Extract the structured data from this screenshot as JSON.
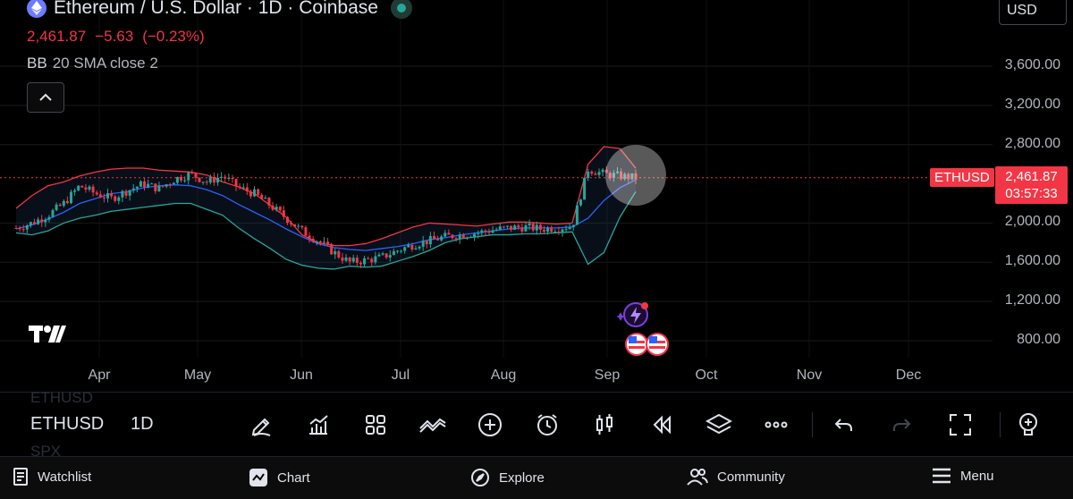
{
  "header": {
    "title": "Ethereum / U.S. Dollar · 1D · Coinbase",
    "price": "2,461.87",
    "change": "−5.63",
    "change_pct": "(−0.23%)",
    "indicator_name": "BB",
    "indicator_params": "20 SMA close 2"
  },
  "currency": {
    "value": "USD"
  },
  "price_axis": {
    "labels": [
      "3,600.00",
      "3,200.00",
      "2,800.00",
      "2,000.00",
      "1,600.00",
      "1,200.00",
      "800.00"
    ],
    "values": [
      3600,
      3200,
      2800,
      2000,
      1600,
      1200,
      800
    ]
  },
  "time_axis": {
    "labels": [
      "Apr",
      "May",
      "Jun",
      "Jul",
      "Aug",
      "Sep",
      "Oct",
      "Nov",
      "Dec"
    ]
  },
  "last_price_tag": {
    "symbol": "ETHUSD",
    "price": "2,461.87",
    "countdown": "03:57:33"
  },
  "colors": {
    "up": "#26a69a",
    "down": "#f23645",
    "bb_upper": "#f23645",
    "bb_basis": "#2962ff",
    "bb_lower": "#26a69a"
  },
  "toolbar": {
    "symbol": "ETHUSD",
    "interval": "1D",
    "ghost_top": "ETHUSD",
    "ghost_bottom": "SPX",
    "icons": [
      "draw-pen-icon",
      "indicators-icon",
      "grid-layout-icon",
      "compare-icon",
      "add-icon",
      "alert-clock-icon",
      "candles-icon",
      "replay-icon",
      "layers-icon",
      "more-icon",
      "undo-icon",
      "redo-icon",
      "fullscreen-icon",
      "idea-bulb-icon"
    ]
  },
  "bottom_nav": {
    "items": [
      {
        "label": "Watchlist",
        "icon": "watchlist-icon"
      },
      {
        "label": "Chart",
        "icon": "chart-icon"
      },
      {
        "label": "Explore",
        "icon": "compass-icon"
      },
      {
        "label": "Community",
        "icon": "people-icon"
      },
      {
        "label": "Menu",
        "icon": "hamburger-icon"
      }
    ]
  },
  "chart_data": {
    "type": "candlestick",
    "symbol": "ETHUSD",
    "interval": "1D",
    "y_range": [
      700,
      3800
    ],
    "x_months": [
      "Apr",
      "May",
      "Jun",
      "Jul",
      "Aug",
      "Sep",
      "Oct",
      "Nov",
      "Dec"
    ],
    "last_price": 2461.87,
    "close_series": [
      1950,
      2000,
      2080,
      2200,
      2380,
      2300,
      2250,
      2330,
      2400,
      2350,
      2450,
      2500,
      2420,
      2480,
      2360,
      2300,
      2180,
      2050,
      1920,
      1820,
      1700,
      1600,
      1620,
      1650,
      1720,
      1780,
      1820,
      1860,
      1880,
      1900,
      1930,
      1950,
      1960,
      1940,
      1950,
      1970,
      2550,
      2500,
      2480,
      2461.87
    ],
    "bb_upper": [
      2150,
      2280,
      2380,
      2420,
      2480,
      2520,
      2550,
      2560,
      2560,
      2540,
      2530,
      2520,
      2490,
      2420,
      2370,
      2300,
      2180,
      2060,
      1880,
      1800,
      1770,
      1770,
      1790,
      1840,
      1900,
      1960,
      2000,
      1990,
      1980,
      1970,
      1990,
      2010,
      2010,
      2000,
      1990,
      2000,
      2600,
      2780,
      2760,
      2560
    ],
    "bb_basis": [
      1940,
      1980,
      2040,
      2110,
      2200,
      2250,
      2300,
      2320,
      2360,
      2380,
      2390,
      2380,
      2340,
      2280,
      2190,
      2110,
      2030,
      1940,
      1860,
      1790,
      1750,
      1730,
      1720,
      1740,
      1760,
      1790,
      1830,
      1850,
      1880,
      1900,
      1920,
      1940,
      1950,
      1950,
      1950,
      1960,
      2050,
      2230,
      2360,
      2440
    ],
    "bb_lower": [
      1900,
      1880,
      1920,
      2000,
      2050,
      2080,
      2120,
      2140,
      2160,
      2180,
      2200,
      2200,
      2140,
      2080,
      1950,
      1840,
      1740,
      1630,
      1570,
      1540,
      1530,
      1560,
      1550,
      1560,
      1610,
      1660,
      1720,
      1800,
      1840,
      1860,
      1880,
      1880,
      1890,
      1890,
      1900,
      1910,
      1580,
      1700,
      2060,
      2320
    ]
  }
}
